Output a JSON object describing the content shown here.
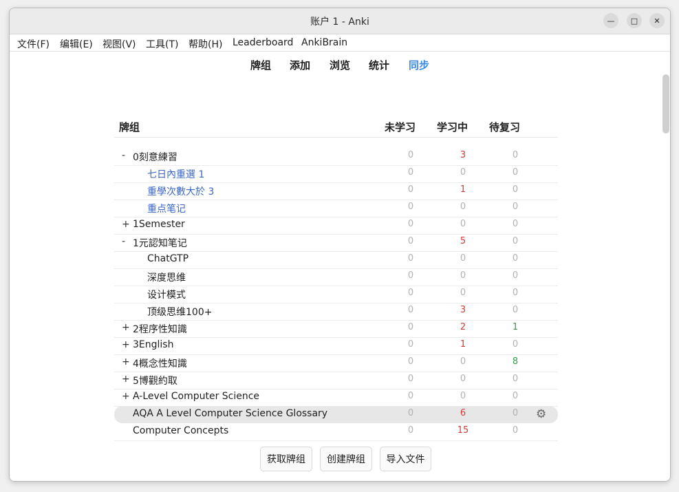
{
  "window": {
    "title": "账户 1 - Anki"
  },
  "menu": [
    "文件(F)",
    "编辑(E)",
    "视图(V)",
    "工具(T)",
    "帮助(H)",
    "Leaderboard",
    "AnkiBrain"
  ],
  "toolbar": {
    "tabs": [
      "牌组",
      "添加",
      "浏览",
      "统计",
      "同步"
    ],
    "active": "同步",
    "accent": "#3a8be0"
  },
  "table": {
    "headers": {
      "deck": "牌组",
      "new": "未学习",
      "learn": "学习中",
      "due": "待复习"
    },
    "rows": [
      {
        "toggle": "-",
        "name": "0刻意練習",
        "new": "0",
        "learn": "3",
        "due": "0"
      },
      {
        "toggle": "",
        "name": "七日內重選 1",
        "new": "0",
        "learn": "0",
        "due": "0"
      },
      {
        "toggle": "",
        "name": "重學次數大於 3",
        "new": "0",
        "learn": "1",
        "due": "0"
      },
      {
        "toggle": "",
        "name": "重点笔记",
        "new": "0",
        "learn": "0",
        "due": "0"
      },
      {
        "toggle": "+",
        "name": "1Semester",
        "new": "0",
        "learn": "0",
        "due": "0"
      },
      {
        "toggle": "-",
        "name": "1元認知笔记",
        "new": "0",
        "learn": "5",
        "due": "0"
      },
      {
        "toggle": "",
        "name": "ChatGTP",
        "new": "0",
        "learn": "0",
        "due": "0"
      },
      {
        "toggle": "",
        "name": "深度思维",
        "new": "0",
        "learn": "0",
        "due": "0"
      },
      {
        "toggle": "",
        "name": "设计模式",
        "new": "0",
        "learn": "0",
        "due": "0"
      },
      {
        "toggle": "",
        "name": "顶级思维100+",
        "new": "0",
        "learn": "3",
        "due": "0"
      },
      {
        "toggle": "+",
        "name": "2程序性知識",
        "new": "0",
        "learn": "2",
        "due": "1"
      },
      {
        "toggle": "+",
        "name": "3English",
        "new": "0",
        "learn": "1",
        "due": "0"
      },
      {
        "toggle": "+",
        "name": "4概念性知識",
        "new": "0",
        "learn": "0",
        "due": "8"
      },
      {
        "toggle": "+",
        "name": "5博觀約取",
        "new": "0",
        "learn": "0",
        "due": "0"
      },
      {
        "toggle": "+",
        "name": "A-Level Computer Science",
        "new": "0",
        "learn": "0",
        "due": "0"
      },
      {
        "toggle": "",
        "name": "AQA A Level Computer Science Glossary",
        "new": "0",
        "learn": "6",
        "due": "0"
      },
      {
        "toggle": "",
        "name": "Computer Concepts",
        "new": "0",
        "learn": "15",
        "due": "0"
      }
    ]
  },
  "buttons": {
    "get_shared": "获取牌组",
    "create": "创建牌组",
    "import": "导入文件"
  },
  "icons": {
    "options": "gear-icon",
    "minimize": "minimize-icon",
    "maximize": "maximize-icon",
    "close": "close-icon"
  }
}
